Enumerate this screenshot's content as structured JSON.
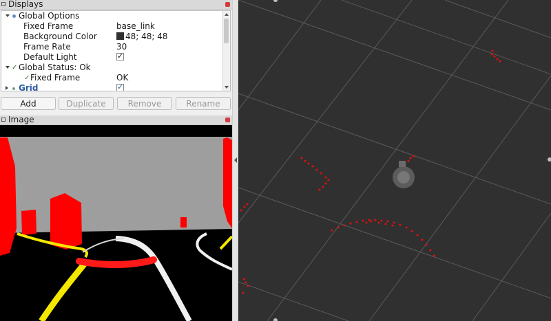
{
  "displays_panel": {
    "title": "Displays",
    "rows": [
      {
        "label": "Global Options",
        "value": ""
      },
      {
        "label": "Fixed Frame",
        "value": "base_link"
      },
      {
        "label": "Background Color",
        "value": "48; 48; 48"
      },
      {
        "label": "Frame Rate",
        "value": "30"
      },
      {
        "label": "Default Light",
        "value": ""
      },
      {
        "label": "Global Status: Ok",
        "value": ""
      },
      {
        "label": "Fixed Frame",
        "value": "OK"
      },
      {
        "label": "Grid",
        "value": ""
      }
    ]
  },
  "buttons": {
    "add": "Add",
    "duplicate": "Duplicate",
    "remove": "Remove",
    "rename": "Rename"
  },
  "image_panel": {
    "title": "Image"
  },
  "colors": {
    "background": "#303030",
    "laser_points": "#e01010",
    "accent": "#2a5ea8"
  },
  "icons": [
    "dock-icon",
    "close-icon",
    "expand-arrow-icon",
    "status-check-icon",
    "checkbox-icon"
  ]
}
